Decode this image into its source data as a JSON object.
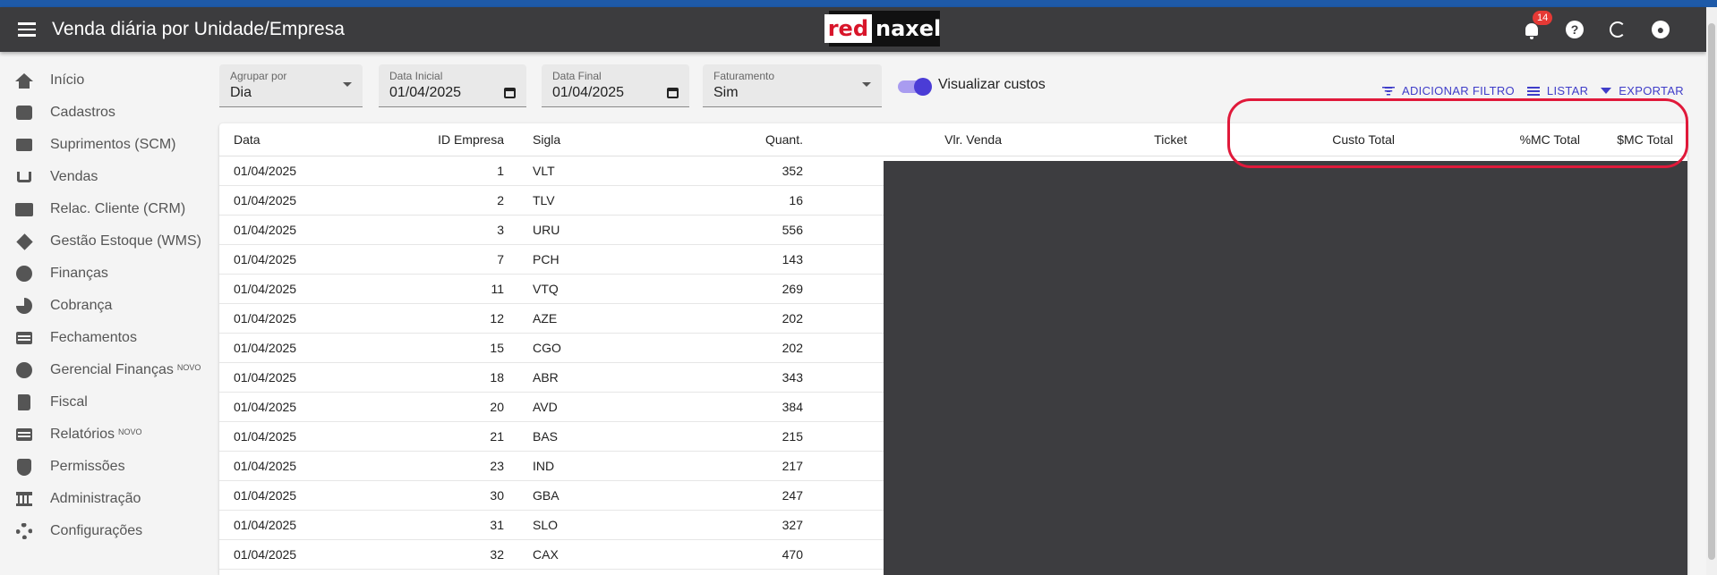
{
  "app": {
    "title": "Venda diária por Unidade/Empresa",
    "logo_part1": "red",
    "logo_part2": "naxel",
    "notification_count": "14",
    "help_glyph": "?"
  },
  "sidebar": {
    "items": [
      {
        "label": "Início",
        "icon": "home-icon"
      },
      {
        "label": "Cadastros",
        "icon": "folder-icon"
      },
      {
        "label": "Suprimentos (SCM)",
        "icon": "truck-icon"
      },
      {
        "label": "Vendas",
        "icon": "cart-icon"
      },
      {
        "label": "Relac. Cliente (CRM)",
        "icon": "contact-card-icon"
      },
      {
        "label": "Gestão Estoque (WMS)",
        "icon": "directions-icon"
      },
      {
        "label": "Finanças",
        "icon": "dollar-icon"
      },
      {
        "label": "Cobrança",
        "icon": "pie-chart-icon"
      },
      {
        "label": "Fechamentos",
        "icon": "list-icon"
      },
      {
        "label": "Gerencial Finanças",
        "icon": "dollar-icon",
        "badge": "NOVO"
      },
      {
        "label": "Fiscal",
        "icon": "book-icon"
      },
      {
        "label": "Relatórios",
        "icon": "document-icon",
        "badge": "NOVO"
      },
      {
        "label": "Permissões",
        "icon": "shield-icon"
      },
      {
        "label": "Administração",
        "icon": "bank-icon"
      },
      {
        "label": "Configurações",
        "icon": "gear-icon"
      }
    ]
  },
  "filters": {
    "group_by": {
      "label": "Agrupar por",
      "value": "Dia"
    },
    "start_date": {
      "label": "Data Inicial",
      "value": "01/04/2025"
    },
    "end_date": {
      "label": "Data Final",
      "value": "01/04/2025"
    },
    "billing": {
      "label": "Faturamento",
      "value": "Sim"
    },
    "show_costs": {
      "label": "Visualizar custos",
      "checked": true
    },
    "actions": {
      "add_filter": "ADICIONAR FILTRO",
      "list": "LISTAR",
      "export": "EXPORTAR"
    }
  },
  "table": {
    "headers": [
      "Data",
      "ID Empresa",
      "Sigla",
      "Quant.",
      "Vlr. Venda",
      "Ticket",
      "Custo Total",
      "%MC Total",
      "$MC Total"
    ],
    "rows": [
      [
        "01/04/2025",
        "1",
        "VLT",
        "352"
      ],
      [
        "01/04/2025",
        "2",
        "TLV",
        "16"
      ],
      [
        "01/04/2025",
        "3",
        "URU",
        "556"
      ],
      [
        "01/04/2025",
        "7",
        "PCH",
        "143"
      ],
      [
        "01/04/2025",
        "11",
        "VTQ",
        "269"
      ],
      [
        "01/04/2025",
        "12",
        "AZE",
        "202"
      ],
      [
        "01/04/2025",
        "15",
        "CGO",
        "202"
      ],
      [
        "01/04/2025",
        "18",
        "ABR",
        "343"
      ],
      [
        "01/04/2025",
        "20",
        "AVD",
        "384"
      ],
      [
        "01/04/2025",
        "21",
        "BAS",
        "215"
      ],
      [
        "01/04/2025",
        "23",
        "IND",
        "217"
      ],
      [
        "01/04/2025",
        "30",
        "GBA",
        "247"
      ],
      [
        "01/04/2025",
        "31",
        "SLO",
        "327"
      ],
      [
        "01/04/2025",
        "32",
        "CAX",
        "470"
      ]
    ]
  },
  "colors": {
    "appbar": "#3c3c3e",
    "accent": "#3f3dc9",
    "highlight": "#e0193a",
    "mask": "#3d3d40"
  }
}
